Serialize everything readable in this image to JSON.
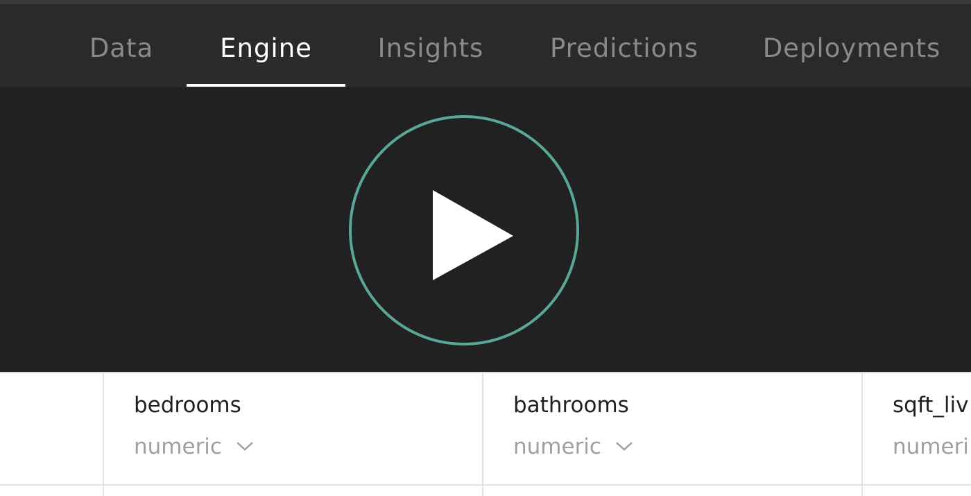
{
  "nav": {
    "tabs": [
      {
        "label": "Data",
        "active": false
      },
      {
        "label": "Engine",
        "active": true
      },
      {
        "label": "Insights",
        "active": false
      },
      {
        "label": "Predictions",
        "active": false
      },
      {
        "label": "Deployments",
        "active": false
      }
    ]
  },
  "video": {
    "play_icon": "play-icon",
    "ring_color": "#5aa698"
  },
  "table": {
    "columns": [
      {
        "name": "bedrooms",
        "type": "numeric"
      },
      {
        "name": "bathrooms",
        "type": "numeric"
      },
      {
        "name": "sqft_liv",
        "type": "numeri"
      }
    ]
  },
  "colors": {
    "nav_bg": "#2a2a2a",
    "video_bg": "#212121",
    "accent_teal": "#5aa698"
  }
}
